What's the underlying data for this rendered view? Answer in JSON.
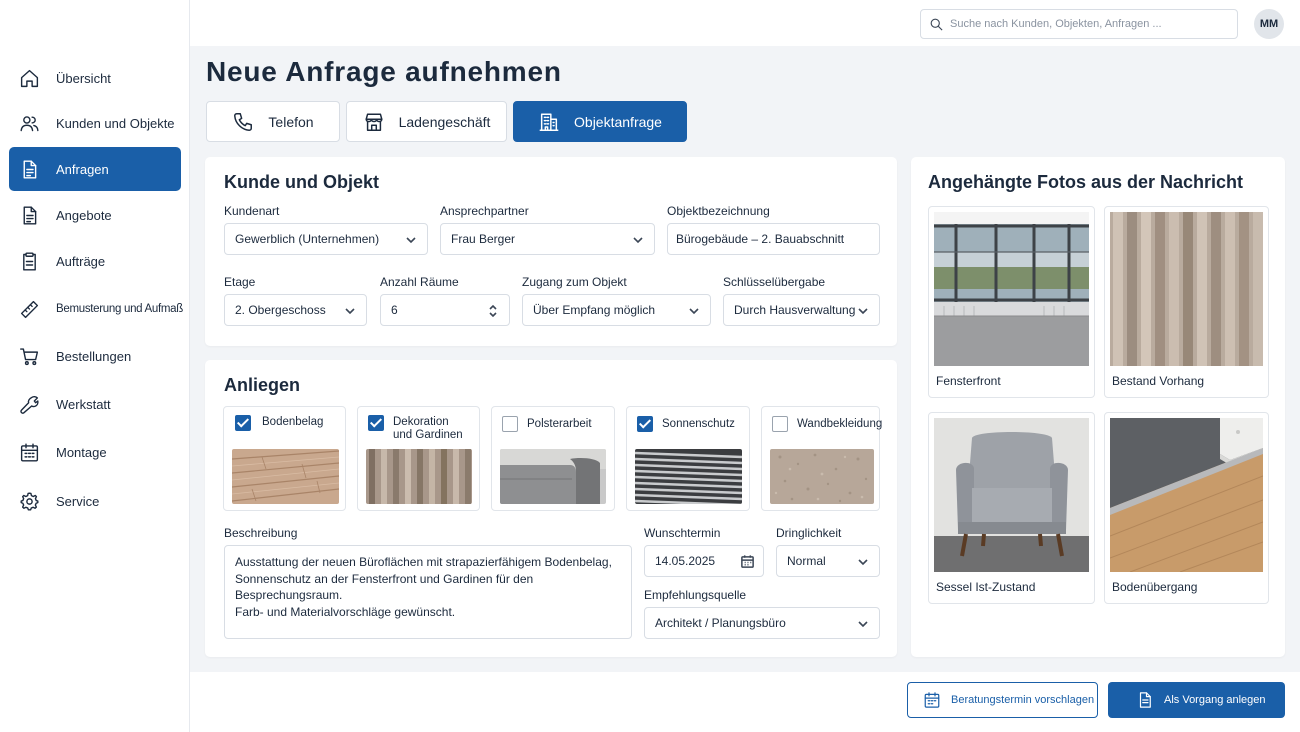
{
  "search": {
    "placeholder": "Suche nach Kunden, Objekten, Anfragen ..."
  },
  "user": {
    "initials": "MM"
  },
  "sidebar": {
    "items": [
      {
        "label": "Übersicht",
        "icon": "home-icon"
      },
      {
        "label": "Kunden und Objekte",
        "icon": "users-icon"
      },
      {
        "label": "Anfragen",
        "icon": "document-icon",
        "active": true
      },
      {
        "label": "Angebote",
        "icon": "document-icon"
      },
      {
        "label": "Aufträge",
        "icon": "clipboard-icon"
      },
      {
        "label": "Bemusterung und Aufmaß",
        "icon": "ruler-icon"
      },
      {
        "label": "Bestellungen",
        "icon": "cart-icon"
      },
      {
        "label": "Werkstatt",
        "icon": "wrench-icon"
      },
      {
        "label": "Montage",
        "icon": "calendar-icon"
      },
      {
        "label": "Service",
        "icon": "gear-icon"
      }
    ]
  },
  "page": {
    "title": "Neue Anfrage aufnehmen"
  },
  "tabs": [
    {
      "label": "Telefon",
      "icon": "phone-icon"
    },
    {
      "label": "Ladengeschäft",
      "icon": "store-icon"
    },
    {
      "label": "Objektanfrage",
      "icon": "building-icon",
      "active": true
    }
  ],
  "kunde": {
    "title": "Kunde und Objekt",
    "kundenart": {
      "label": "Kundenart",
      "value": "Gewerblich (Unternehmen)"
    },
    "ansprechpartner": {
      "label": "Ansprechpartner",
      "value": "Frau Berger"
    },
    "objektbezeichnung": {
      "label": "Objektbezeichnung",
      "value": "Bürogebäude – 2. Bauabschnitt"
    },
    "etage": {
      "label": "Etage",
      "value": "2. Obergeschoss"
    },
    "raeume": {
      "label": "Anzahl Räume",
      "value": "6"
    },
    "zugang": {
      "label": "Zugang zum Objekt",
      "value": "Über Empfang möglich"
    },
    "schluessel": {
      "label": "Schlüsselübergabe",
      "value": "Durch Hausverwaltung"
    }
  },
  "anliegen": {
    "title": "Anliegen",
    "options": [
      {
        "label": "Bodenbelag",
        "checked": true
      },
      {
        "label_1": "Dekoration",
        "label_2": "und Gardinen",
        "checked": true
      },
      {
        "label": "Polsterarbeit",
        "checked": false
      },
      {
        "label": "Sonnenschutz",
        "checked": true
      },
      {
        "label": "Wandbekleidung",
        "checked": false
      }
    ],
    "beschreibung": {
      "label": "Beschreibung",
      "line1": "Ausstattung der neuen Büroflächen mit strapazierfähigem Bodenbelag,",
      "line2": "Sonnenschutz an der Fensterfront und Gardinen für den Besprechungsraum.",
      "line3": "Farb- und Materialvorschläge gewünscht."
    },
    "wunschtermin": {
      "label": "Wunschtermin",
      "value": "14.05.2025"
    },
    "dringlichkeit": {
      "label": "Dringlichkeit",
      "value": "Normal"
    },
    "empfehlung": {
      "label": "Empfehlungsquelle",
      "value": "Architekt / Planungsbüro"
    }
  },
  "photos": {
    "title": "Angehängte Fotos aus der Nachricht",
    "items": [
      {
        "caption": "Fensterfront"
      },
      {
        "caption": "Bestand Vorhang"
      },
      {
        "caption": "Sessel Ist-Zustand"
      },
      {
        "caption": "Bodenübergang"
      }
    ]
  },
  "actions": {
    "secondary": "Beratungstermin vorschlagen",
    "primary": "Als Vorgang anlegen"
  },
  "colors": {
    "accent": "#1a5fa8",
    "text": "#1c2a3d",
    "background": "#f2f4f7"
  }
}
